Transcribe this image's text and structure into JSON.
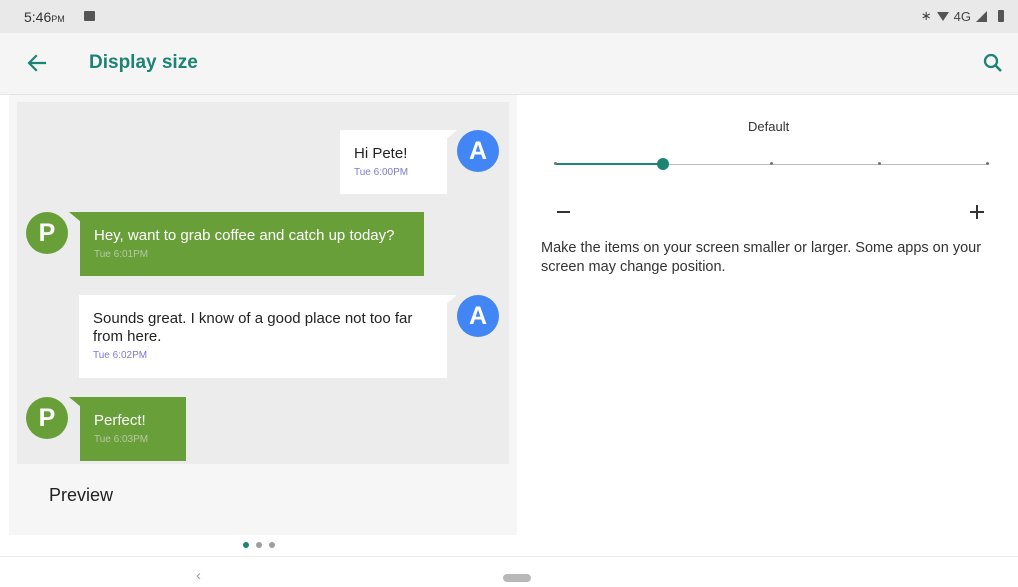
{
  "status_bar": {
    "time": "5:46",
    "ampm": "PM",
    "network": "4G",
    "icons": [
      "image-notification-icon",
      "bluetooth-icon",
      "wifi-icon",
      "signal-icon",
      "battery-icon"
    ]
  },
  "app_bar": {
    "title": "Display size",
    "back_icon": "arrow-back-icon",
    "search_icon": "search-icon",
    "accent_color": "#1d8373"
  },
  "preview": {
    "label": "Preview",
    "messages": [
      {
        "sender": "A",
        "text": "Hi Pete!",
        "time": "Tue 6:00PM",
        "side": "right",
        "color": "#4285f4"
      },
      {
        "sender": "P",
        "text": "Hey, want to grab coffee and catch up today?",
        "time": "Tue 6:01PM",
        "side": "left",
        "color": "#689f38"
      },
      {
        "sender": "A",
        "text": "Sounds great. I know of a good place not too far from here.",
        "time": "Tue 6:02PM",
        "side": "right",
        "color": "#4285f4"
      },
      {
        "sender": "P",
        "text": "Perfect!",
        "time": "Tue 6:03PM",
        "side": "left",
        "color": "#689f38"
      }
    ],
    "page_indicator": {
      "count": 3,
      "active": 0
    }
  },
  "size_control": {
    "current_label": "Default",
    "levels": 5,
    "selected_index": 1,
    "minus_label": "−",
    "plus_label": "+",
    "description": "Make the items on your screen smaller or larger. Some apps on your screen may change position."
  },
  "nav_bar": {
    "back_glyph": "‹"
  }
}
